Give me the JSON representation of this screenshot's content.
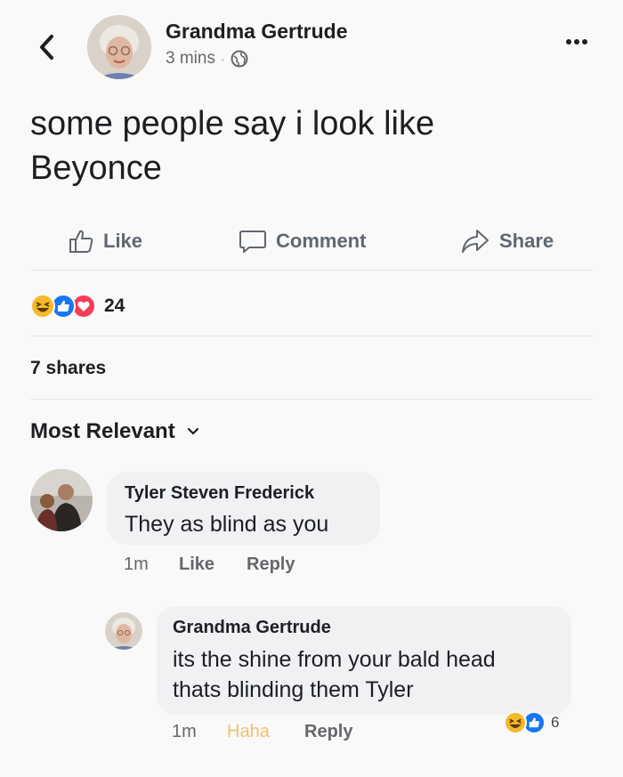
{
  "header": {
    "author": "Grandma Gertrude",
    "time": "3 mins",
    "dot": "·"
  },
  "post": {
    "text_line1": "some people say i look like",
    "text_line2": "Beyonce"
  },
  "actions": {
    "like": "Like",
    "comment": "Comment",
    "share": "Share"
  },
  "reactions": {
    "count": "24",
    "types": [
      "haha-icon",
      "like-icon",
      "love-icon"
    ]
  },
  "shares": "7 shares",
  "sort_label": "Most Relevant",
  "comments": [
    {
      "author": "Tyler Steven Frederick",
      "text": "They as blind as you",
      "time": "1m",
      "like": "Like",
      "reply": "Reply"
    },
    {
      "author": "Grandma Gertrude",
      "text_line1": "its the shine from your bald head",
      "text_line2": "thats blinding them Tyler",
      "time": "1m",
      "reaction_label": "Haha",
      "reply": "Reply",
      "reaction_count": "6"
    }
  ],
  "colors": {
    "like_blue": "#1877f2",
    "love_red": "#f33e58",
    "haha_yellow": "#f7b928",
    "haha_text": "#f3c26a",
    "secondary_text": "#65676b"
  }
}
